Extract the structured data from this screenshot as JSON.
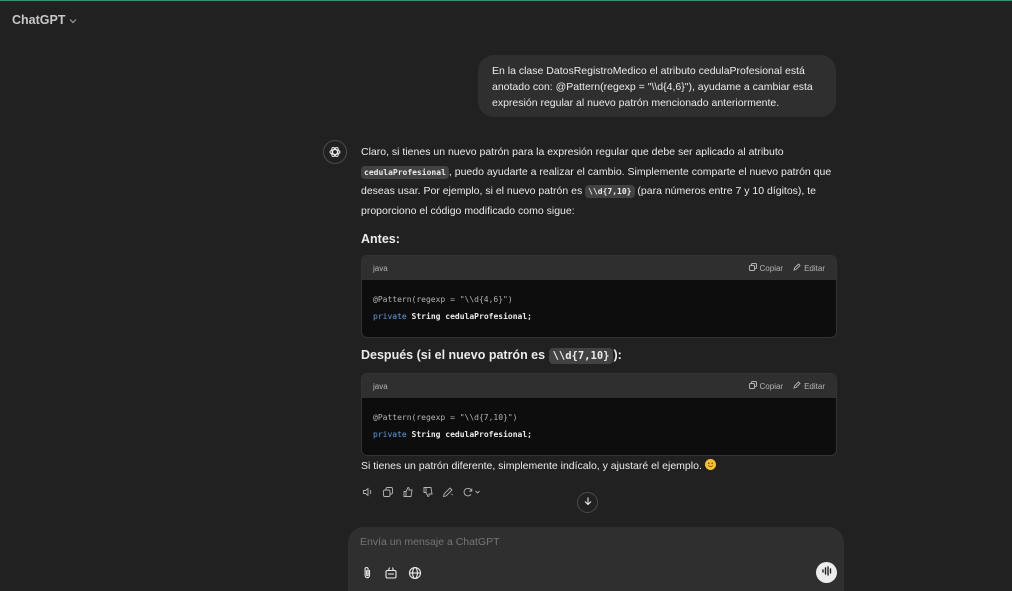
{
  "header": {
    "model": "ChatGPT"
  },
  "user_message": "En la clase DatosRegistroMedico el atributo cedulaProfesional está anotado con: @Pattern(regexp = \"\\\\d{4,6}\"), ayudame a cambiar esta expresión regular al nuevo patrón mencionado anteriormente.",
  "assistant": {
    "intro_1": "Claro, si tienes un nuevo patrón para la expresión regular que debe ser aplicado al atributo ",
    "intro_code_1": "cedulaProfesional",
    "intro_2": ", puedo ayudarte a realizar el cambio. Simplemente comparte el nuevo patrón que deseas usar. Por ejemplo, si el nuevo patrón es ",
    "intro_code_2": "\\\\d{7,10}",
    "intro_3": " (para números entre 7 y 10 dígitos), te proporciono el código modificado como sigue:",
    "heading_before": "Antes:",
    "heading_after_prefix": "Después (si el nuevo patrón es ",
    "heading_after_code": "\\\\d{7,10}",
    "heading_after_suffix": "):",
    "code_before": {
      "lang": "java",
      "copy_label": "Copiar",
      "edit_label": "Editar",
      "line1": "@Pattern(regexp = \"\\\\d{4,6}\")",
      "kw": "private",
      "type": "String",
      "var": "cedulaProfesional;"
    },
    "code_after": {
      "lang": "java",
      "copy_label": "Copiar",
      "edit_label": "Editar",
      "line1": "@Pattern(regexp = \"\\\\d{7,10}\")",
      "kw": "private",
      "type": "String",
      "var": "cedulaProfesional;"
    },
    "closing": "Si tienes un patrón diferente, simplemente indícalo, y ajustaré el ejemplo. "
  },
  "composer": {
    "placeholder": "Envía un mensaje a ChatGPT"
  },
  "icons": {
    "avatar": "openai-logo-icon",
    "copy": "copy-icon",
    "edit": "edit-icon",
    "read_aloud": "speaker-icon",
    "thumbs_up": "thumbs-up-icon",
    "thumbs_down": "thumbs-down-icon",
    "regenerate": "regenerate-icon",
    "attach": "paperclip-icon",
    "tools": "tools-icon",
    "web": "globe-icon",
    "voice": "voice-waveform-icon",
    "scroll": "arrow-down-icon"
  },
  "colors": {
    "background": "#212121",
    "bubble": "#2f2f2f",
    "code_bg": "#0d0d0d",
    "keyword": "#5aa0e6"
  }
}
